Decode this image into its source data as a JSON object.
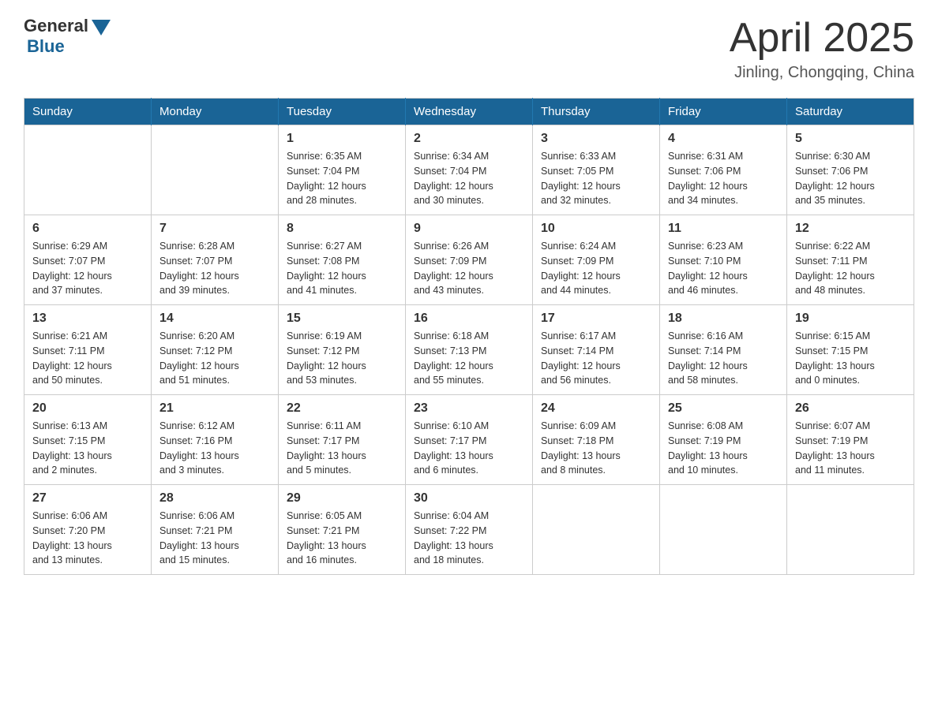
{
  "header": {
    "logo_general": "General",
    "logo_blue": "Blue",
    "month_title": "April 2025",
    "location": "Jinling, Chongqing, China"
  },
  "days_of_week": [
    "Sunday",
    "Monday",
    "Tuesday",
    "Wednesday",
    "Thursday",
    "Friday",
    "Saturday"
  ],
  "weeks": [
    [
      {
        "day": "",
        "info": ""
      },
      {
        "day": "",
        "info": ""
      },
      {
        "day": "1",
        "info": "Sunrise: 6:35 AM\nSunset: 7:04 PM\nDaylight: 12 hours\nand 28 minutes."
      },
      {
        "day": "2",
        "info": "Sunrise: 6:34 AM\nSunset: 7:04 PM\nDaylight: 12 hours\nand 30 minutes."
      },
      {
        "day": "3",
        "info": "Sunrise: 6:33 AM\nSunset: 7:05 PM\nDaylight: 12 hours\nand 32 minutes."
      },
      {
        "day": "4",
        "info": "Sunrise: 6:31 AM\nSunset: 7:06 PM\nDaylight: 12 hours\nand 34 minutes."
      },
      {
        "day": "5",
        "info": "Sunrise: 6:30 AM\nSunset: 7:06 PM\nDaylight: 12 hours\nand 35 minutes."
      }
    ],
    [
      {
        "day": "6",
        "info": "Sunrise: 6:29 AM\nSunset: 7:07 PM\nDaylight: 12 hours\nand 37 minutes."
      },
      {
        "day": "7",
        "info": "Sunrise: 6:28 AM\nSunset: 7:07 PM\nDaylight: 12 hours\nand 39 minutes."
      },
      {
        "day": "8",
        "info": "Sunrise: 6:27 AM\nSunset: 7:08 PM\nDaylight: 12 hours\nand 41 minutes."
      },
      {
        "day": "9",
        "info": "Sunrise: 6:26 AM\nSunset: 7:09 PM\nDaylight: 12 hours\nand 43 minutes."
      },
      {
        "day": "10",
        "info": "Sunrise: 6:24 AM\nSunset: 7:09 PM\nDaylight: 12 hours\nand 44 minutes."
      },
      {
        "day": "11",
        "info": "Sunrise: 6:23 AM\nSunset: 7:10 PM\nDaylight: 12 hours\nand 46 minutes."
      },
      {
        "day": "12",
        "info": "Sunrise: 6:22 AM\nSunset: 7:11 PM\nDaylight: 12 hours\nand 48 minutes."
      }
    ],
    [
      {
        "day": "13",
        "info": "Sunrise: 6:21 AM\nSunset: 7:11 PM\nDaylight: 12 hours\nand 50 minutes."
      },
      {
        "day": "14",
        "info": "Sunrise: 6:20 AM\nSunset: 7:12 PM\nDaylight: 12 hours\nand 51 minutes."
      },
      {
        "day": "15",
        "info": "Sunrise: 6:19 AM\nSunset: 7:12 PM\nDaylight: 12 hours\nand 53 minutes."
      },
      {
        "day": "16",
        "info": "Sunrise: 6:18 AM\nSunset: 7:13 PM\nDaylight: 12 hours\nand 55 minutes."
      },
      {
        "day": "17",
        "info": "Sunrise: 6:17 AM\nSunset: 7:14 PM\nDaylight: 12 hours\nand 56 minutes."
      },
      {
        "day": "18",
        "info": "Sunrise: 6:16 AM\nSunset: 7:14 PM\nDaylight: 12 hours\nand 58 minutes."
      },
      {
        "day": "19",
        "info": "Sunrise: 6:15 AM\nSunset: 7:15 PM\nDaylight: 13 hours\nand 0 minutes."
      }
    ],
    [
      {
        "day": "20",
        "info": "Sunrise: 6:13 AM\nSunset: 7:15 PM\nDaylight: 13 hours\nand 2 minutes."
      },
      {
        "day": "21",
        "info": "Sunrise: 6:12 AM\nSunset: 7:16 PM\nDaylight: 13 hours\nand 3 minutes."
      },
      {
        "day": "22",
        "info": "Sunrise: 6:11 AM\nSunset: 7:17 PM\nDaylight: 13 hours\nand 5 minutes."
      },
      {
        "day": "23",
        "info": "Sunrise: 6:10 AM\nSunset: 7:17 PM\nDaylight: 13 hours\nand 6 minutes."
      },
      {
        "day": "24",
        "info": "Sunrise: 6:09 AM\nSunset: 7:18 PM\nDaylight: 13 hours\nand 8 minutes."
      },
      {
        "day": "25",
        "info": "Sunrise: 6:08 AM\nSunset: 7:19 PM\nDaylight: 13 hours\nand 10 minutes."
      },
      {
        "day": "26",
        "info": "Sunrise: 6:07 AM\nSunset: 7:19 PM\nDaylight: 13 hours\nand 11 minutes."
      }
    ],
    [
      {
        "day": "27",
        "info": "Sunrise: 6:06 AM\nSunset: 7:20 PM\nDaylight: 13 hours\nand 13 minutes."
      },
      {
        "day": "28",
        "info": "Sunrise: 6:06 AM\nSunset: 7:21 PM\nDaylight: 13 hours\nand 15 minutes."
      },
      {
        "day": "29",
        "info": "Sunrise: 6:05 AM\nSunset: 7:21 PM\nDaylight: 13 hours\nand 16 minutes."
      },
      {
        "day": "30",
        "info": "Sunrise: 6:04 AM\nSunset: 7:22 PM\nDaylight: 13 hours\nand 18 minutes."
      },
      {
        "day": "",
        "info": ""
      },
      {
        "day": "",
        "info": ""
      },
      {
        "day": "",
        "info": ""
      }
    ]
  ]
}
